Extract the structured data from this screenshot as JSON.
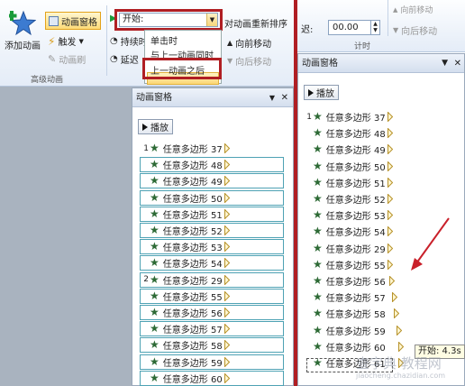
{
  "ribbon": {
    "add_animation": "添加动画",
    "animation_pane": "动画窗格",
    "trigger": "触发",
    "animation_painter": "动画刷",
    "advanced_group": "高级动画",
    "start_label": "开始:",
    "duration_label": "持续时",
    "delay_label": "延迟",
    "reorder_title": "对动画重新排序",
    "move_earlier": "向前移动",
    "move_later": "向后移动",
    "timing_group": "计时"
  },
  "start_dropdown": {
    "options": [
      "单击时",
      "与上一动画同时",
      "上一动画之后"
    ],
    "selected": "上一动画之后"
  },
  "right_ribbon": {
    "delay_label": "迟:",
    "delay_value": "00.00",
    "move_earlier": "向前移动",
    "move_later": "向后移动",
    "timing_group": "计时"
  },
  "pane_left": {
    "title": "动画窗格",
    "play_label": "播放",
    "items": [
      {
        "num": "1",
        "name": "任意多边形",
        "id": "37"
      },
      {
        "num": "",
        "name": "任意多边形",
        "id": "48"
      },
      {
        "num": "",
        "name": "任意多边形",
        "id": "49"
      },
      {
        "num": "",
        "name": "任意多边形",
        "id": "50"
      },
      {
        "num": "",
        "name": "任意多边形",
        "id": "51"
      },
      {
        "num": "",
        "name": "任意多边形",
        "id": "52"
      },
      {
        "num": "",
        "name": "任意多边形",
        "id": "53"
      },
      {
        "num": "",
        "name": "任意多边形",
        "id": "54"
      },
      {
        "num": "2",
        "name": "任意多边形",
        "id": "29"
      },
      {
        "num": "",
        "name": "任意多边形",
        "id": "55"
      },
      {
        "num": "",
        "name": "任意多边形",
        "id": "56"
      },
      {
        "num": "",
        "name": "任意多边形",
        "id": "57"
      },
      {
        "num": "",
        "name": "任意多边形",
        "id": "58"
      },
      {
        "num": "",
        "name": "任意多边形",
        "id": "59"
      },
      {
        "num": "",
        "name": "任意多边形",
        "id": "60"
      }
    ]
  },
  "pane_right": {
    "title": "动画窗格",
    "play_label": "播放",
    "items": [
      {
        "num": "1",
        "name": "任意多边形",
        "id": "37"
      },
      {
        "num": "",
        "name": "任意多边形",
        "id": "48"
      },
      {
        "num": "",
        "name": "任意多边形",
        "id": "49"
      },
      {
        "num": "",
        "name": "任意多边形",
        "id": "50"
      },
      {
        "num": "",
        "name": "任意多边形",
        "id": "51"
      },
      {
        "num": "",
        "name": "任意多边形",
        "id": "52"
      },
      {
        "num": "",
        "name": "任意多边形",
        "id": "53"
      },
      {
        "num": "",
        "name": "任意多边形",
        "id": "54"
      },
      {
        "num": "",
        "name": "任意多边形",
        "id": "29"
      },
      {
        "num": "",
        "name": "任意多边形",
        "id": "55"
      },
      {
        "num": "",
        "name": "任意多边形",
        "id": "56"
      },
      {
        "num": "",
        "name": "任意多边形",
        "id": "57"
      },
      {
        "num": "",
        "name": "任意多边形",
        "id": "58"
      },
      {
        "num": "",
        "name": "任意多边形",
        "id": "59"
      },
      {
        "num": "",
        "name": "任意多边形",
        "id": "60"
      },
      {
        "num": "",
        "name": "任意多边形",
        "id": "61"
      }
    ],
    "tooltip": "开始: 4.3s"
  },
  "watermark": {
    "line1": "查字典 教程网",
    "line2": "jiaocheng.chazidian.com"
  },
  "colors": {
    "highlight_red": "#b01e23",
    "star_green": "#2d6a35",
    "row_border": "#4ea2b4"
  }
}
